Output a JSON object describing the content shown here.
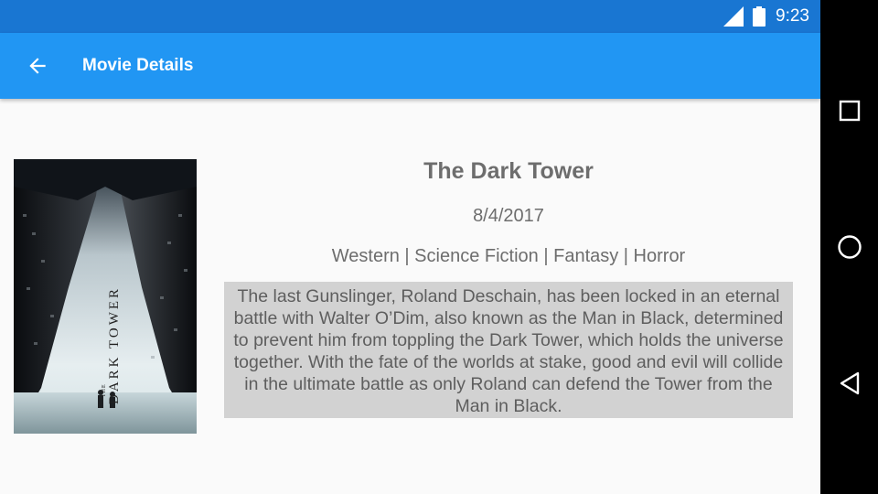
{
  "status_bar": {
    "time": "9:23",
    "icons": [
      "signal-icon",
      "battery-icon"
    ]
  },
  "app_bar": {
    "title": "Movie Details",
    "back_icon": "arrow-back-icon",
    "color": "#2196f3"
  },
  "movie": {
    "title": "The Dark Tower",
    "release_date": "8/4/2017",
    "genres": "Western | Science Fiction | Fantasy | Horror",
    "overview": "The last Gunslinger, Roland Deschain, has been locked in an eternal battle with Walter O’Dim, also known as the Man in Black, determined to prevent him from toppling the Dark Tower, which holds the universe together. With the fate of the worlds at stake, good and evil will collide in the ultimate battle as only Roland can defend the Tower from the Man in Black.",
    "poster": {
      "title_small": "THE",
      "title_main": "DARK TOWER"
    }
  },
  "nav_bar": {
    "buttons": [
      "recents-square-icon",
      "home-circle-icon",
      "back-triangle-icon"
    ]
  },
  "colors": {
    "status_bar": "#1976d2",
    "app_bar": "#2196f3",
    "text": "#6d6d6d",
    "overview_bg": "#d2d2d2"
  }
}
